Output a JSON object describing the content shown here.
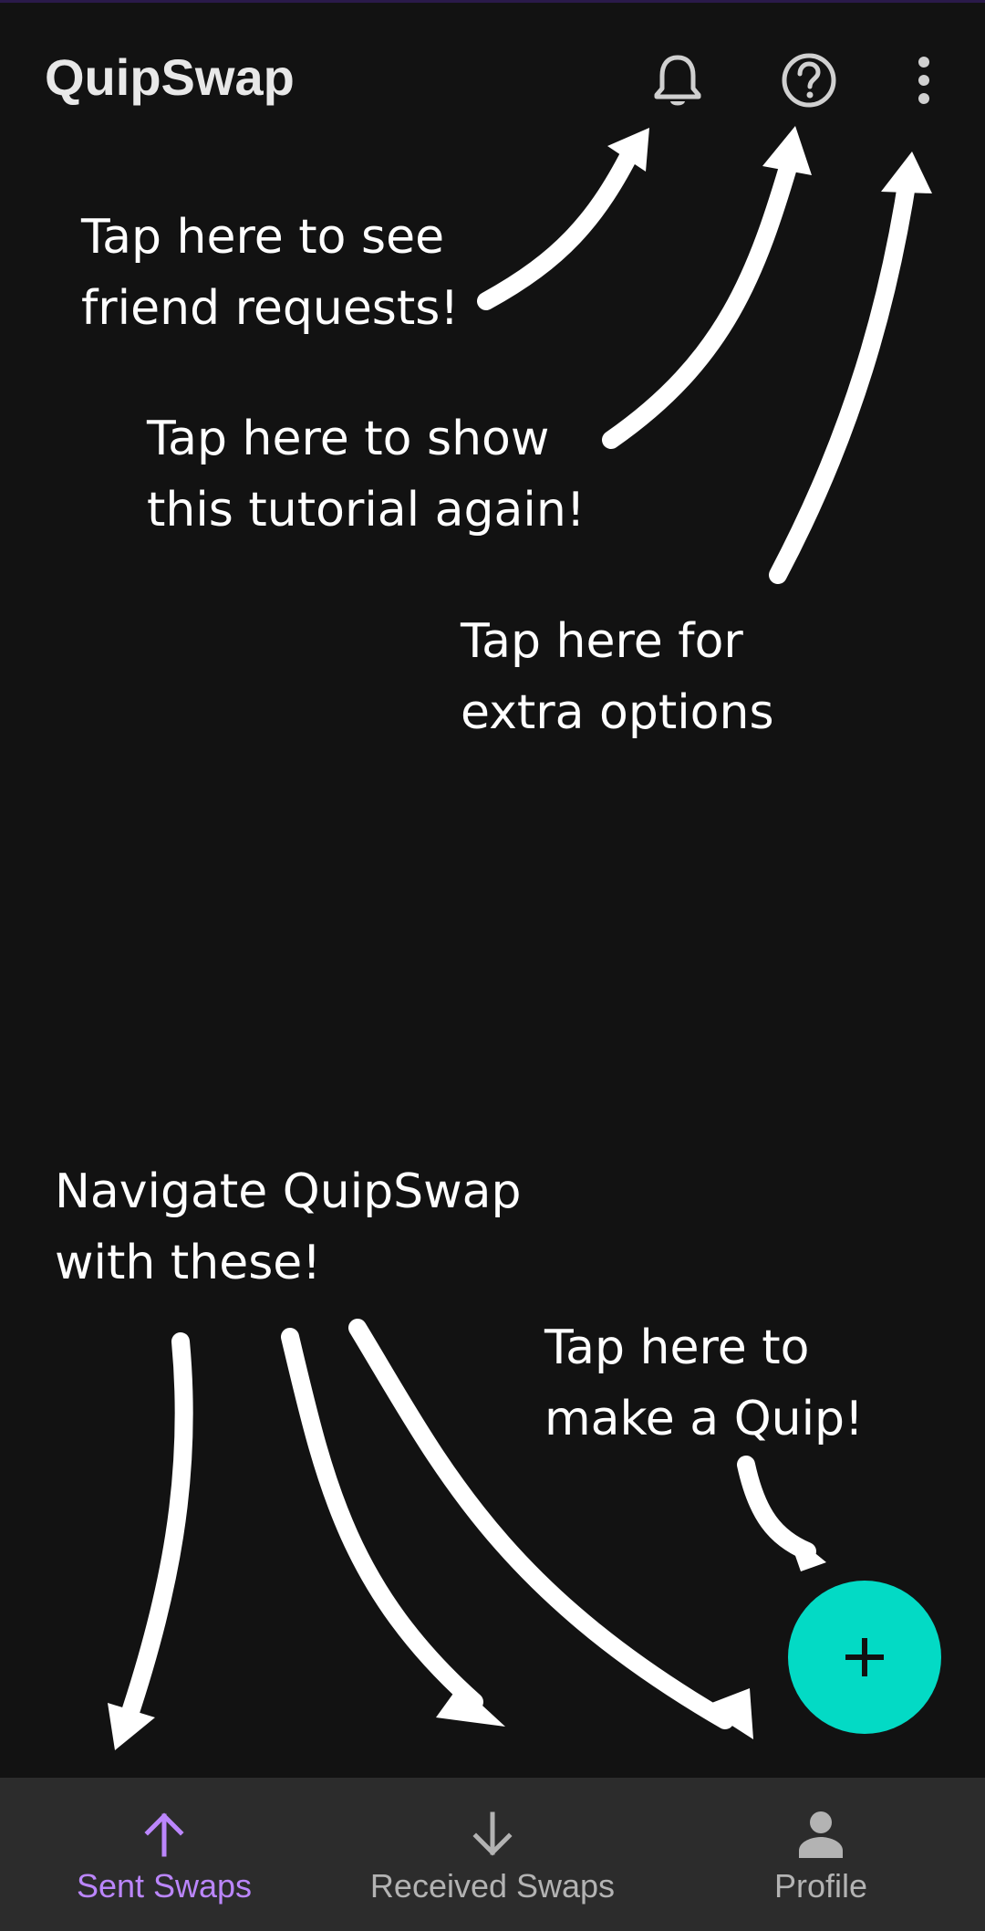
{
  "app": {
    "title": "QuipSwap"
  },
  "toolbar": {
    "actions": [
      {
        "icon": "bell-icon",
        "label": "Notifications"
      },
      {
        "icon": "help-circle-icon",
        "label": "Help"
      },
      {
        "icon": "more-vertical-icon",
        "label": "More options"
      }
    ]
  },
  "tutorial": {
    "notifications_hint": "Tap here to see\nfriend requests!",
    "help_hint": "Tap here to show\nthis tutorial again!",
    "options_hint": "Tap here for\nextra options",
    "navigation_hint": "Navigate QuipSwap\nwith these!",
    "fab_hint": "Tap here to\nmake a Quip!"
  },
  "fab": {
    "icon": "plus-icon",
    "color": "#03dac5"
  },
  "bottom_nav": {
    "items": [
      {
        "label": "Sent Swaps",
        "icon": "arrow-up-icon",
        "active": true
      },
      {
        "label": "Received Swaps",
        "icon": "arrow-down-icon",
        "active": false
      },
      {
        "label": "Profile",
        "icon": "person-icon",
        "active": false
      }
    ]
  },
  "colors": {
    "background": "#121212",
    "accent": "#bb86fc",
    "fab": "#03dac5",
    "nav_background": "#2c2c2c",
    "inactive": "#b3b3b3"
  }
}
